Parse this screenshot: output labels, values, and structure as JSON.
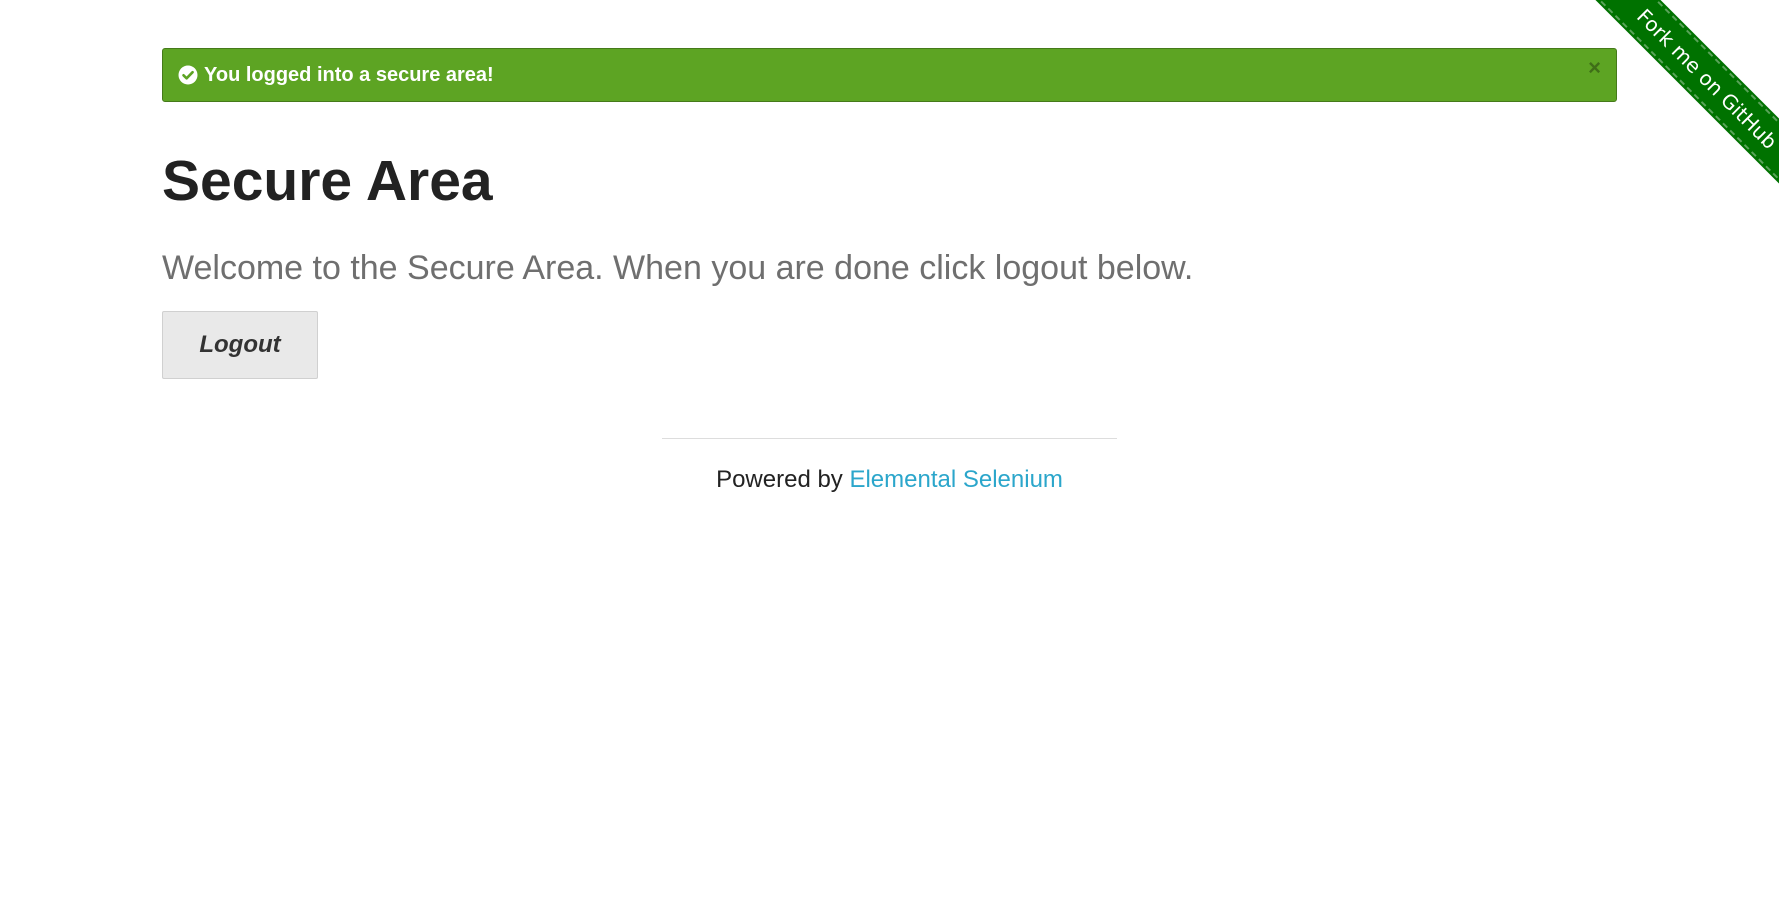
{
  "flash": {
    "message": "You logged into a secure area!",
    "close_label": "×",
    "color": "#5da423"
  },
  "main": {
    "title": "Secure Area",
    "subheader": "Welcome to the Secure Area. When you are done click logout below.",
    "logout_label": "Logout"
  },
  "footer": {
    "powered_by": "Powered by ",
    "link_label": "Elemental Selenium",
    "link_color": "#2ba6cb"
  },
  "ribbon": {
    "label": "Fork me on GitHub",
    "color": "#007200"
  },
  "icons": {
    "flash_icon": "check-circle-icon",
    "close_icon": "close-icon"
  }
}
